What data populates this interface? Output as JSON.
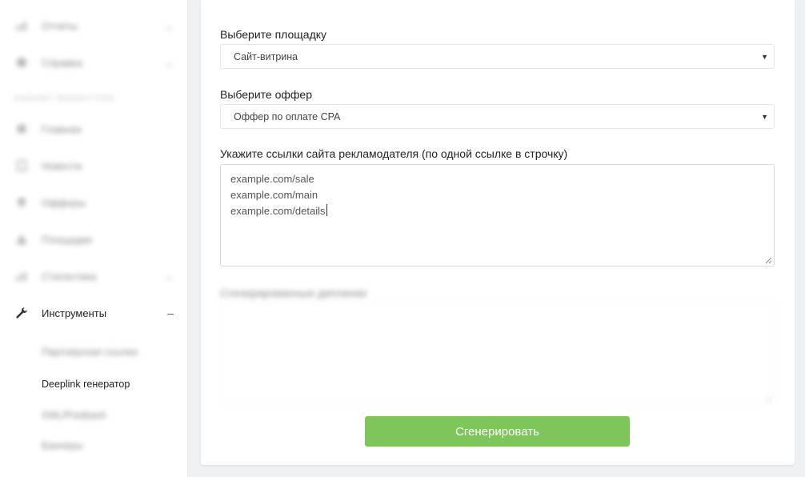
{
  "sidebar": {
    "items_top": [
      {
        "label": "Отчеты",
        "icon": "chart-icon"
      },
      {
        "label": "Справка",
        "icon": "help-icon"
      }
    ],
    "section_caption": "Кабинет вебмастера",
    "items": [
      {
        "label": "Главная",
        "icon": "home-icon"
      },
      {
        "label": "Новости",
        "icon": "news-icon"
      },
      {
        "label": "Офферы",
        "icon": "offers-icon"
      },
      {
        "label": "Площадки",
        "icon": "platforms-icon"
      },
      {
        "label": "Статистика",
        "icon": "stats-icon"
      }
    ],
    "active_section": {
      "label": "Инструменты",
      "icon": "wrench-icon",
      "toggle": "–"
    },
    "sub_items": [
      {
        "label": "Партнерская ссылка"
      },
      {
        "label": "Deeplink генератор"
      },
      {
        "label": "XML/Postback"
      },
      {
        "label": "Баннеры"
      }
    ]
  },
  "form": {
    "platform_label": "Выберите площадку",
    "platform_value": "Сайт-витрина",
    "offer_label": "Выберите оффер",
    "offer_value": "Оффер по оплате CPA",
    "links_label": "Укажите ссылки сайта рекламодателя (по одной ссылке в строчку)",
    "links_lines": [
      "example.com/sale",
      "example.com/main",
      "example.com/details"
    ],
    "generated_label": "Сгенерированные диплинки",
    "generate_button": "Сгенерировать"
  },
  "colors": {
    "accent_green": "#7ec55a",
    "background": "#eef0f2"
  }
}
